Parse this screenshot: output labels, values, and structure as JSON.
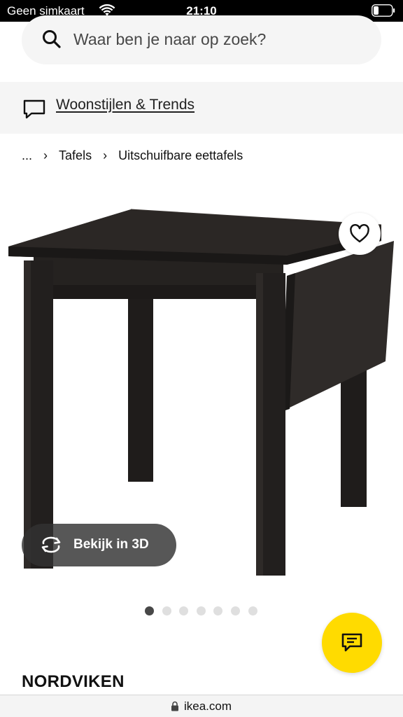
{
  "status_bar": {
    "carrier": "Geen simkaart",
    "time": "21:10",
    "wifi_icon": "wifi-icon",
    "battery_icon": "battery-icon"
  },
  "search": {
    "placeholder": "Waar ben je naar op zoek?",
    "icon": "search-icon"
  },
  "promo": {
    "label": "Woonstijlen & Trends",
    "icon": "chat-bubble-icon"
  },
  "breadcrumb": {
    "ellipsis": "...",
    "items": [
      "Tafels",
      "Uitschuifbare eettafels"
    ],
    "separator": "›"
  },
  "product": {
    "name": "NORDVIKEN",
    "image_icon": "drop-leaf-table-image",
    "wishlist_icon": "heart-icon",
    "view_3d_label": "Bekijk in 3D",
    "view_3d_icon": "rotate-3d-icon",
    "carousel": {
      "count": 7,
      "active_index": 0
    }
  },
  "chat_fab": {
    "icon": "chat-icon"
  },
  "browser": {
    "url": "ikea.com",
    "lock_icon": "lock-icon"
  },
  "colors": {
    "accent_yellow": "#ffdb00",
    "status_bar_bg": "#000000",
    "surface_grey": "#f5f5f5",
    "text_dark": "#111111",
    "table_black_brown": "#2b2725"
  }
}
